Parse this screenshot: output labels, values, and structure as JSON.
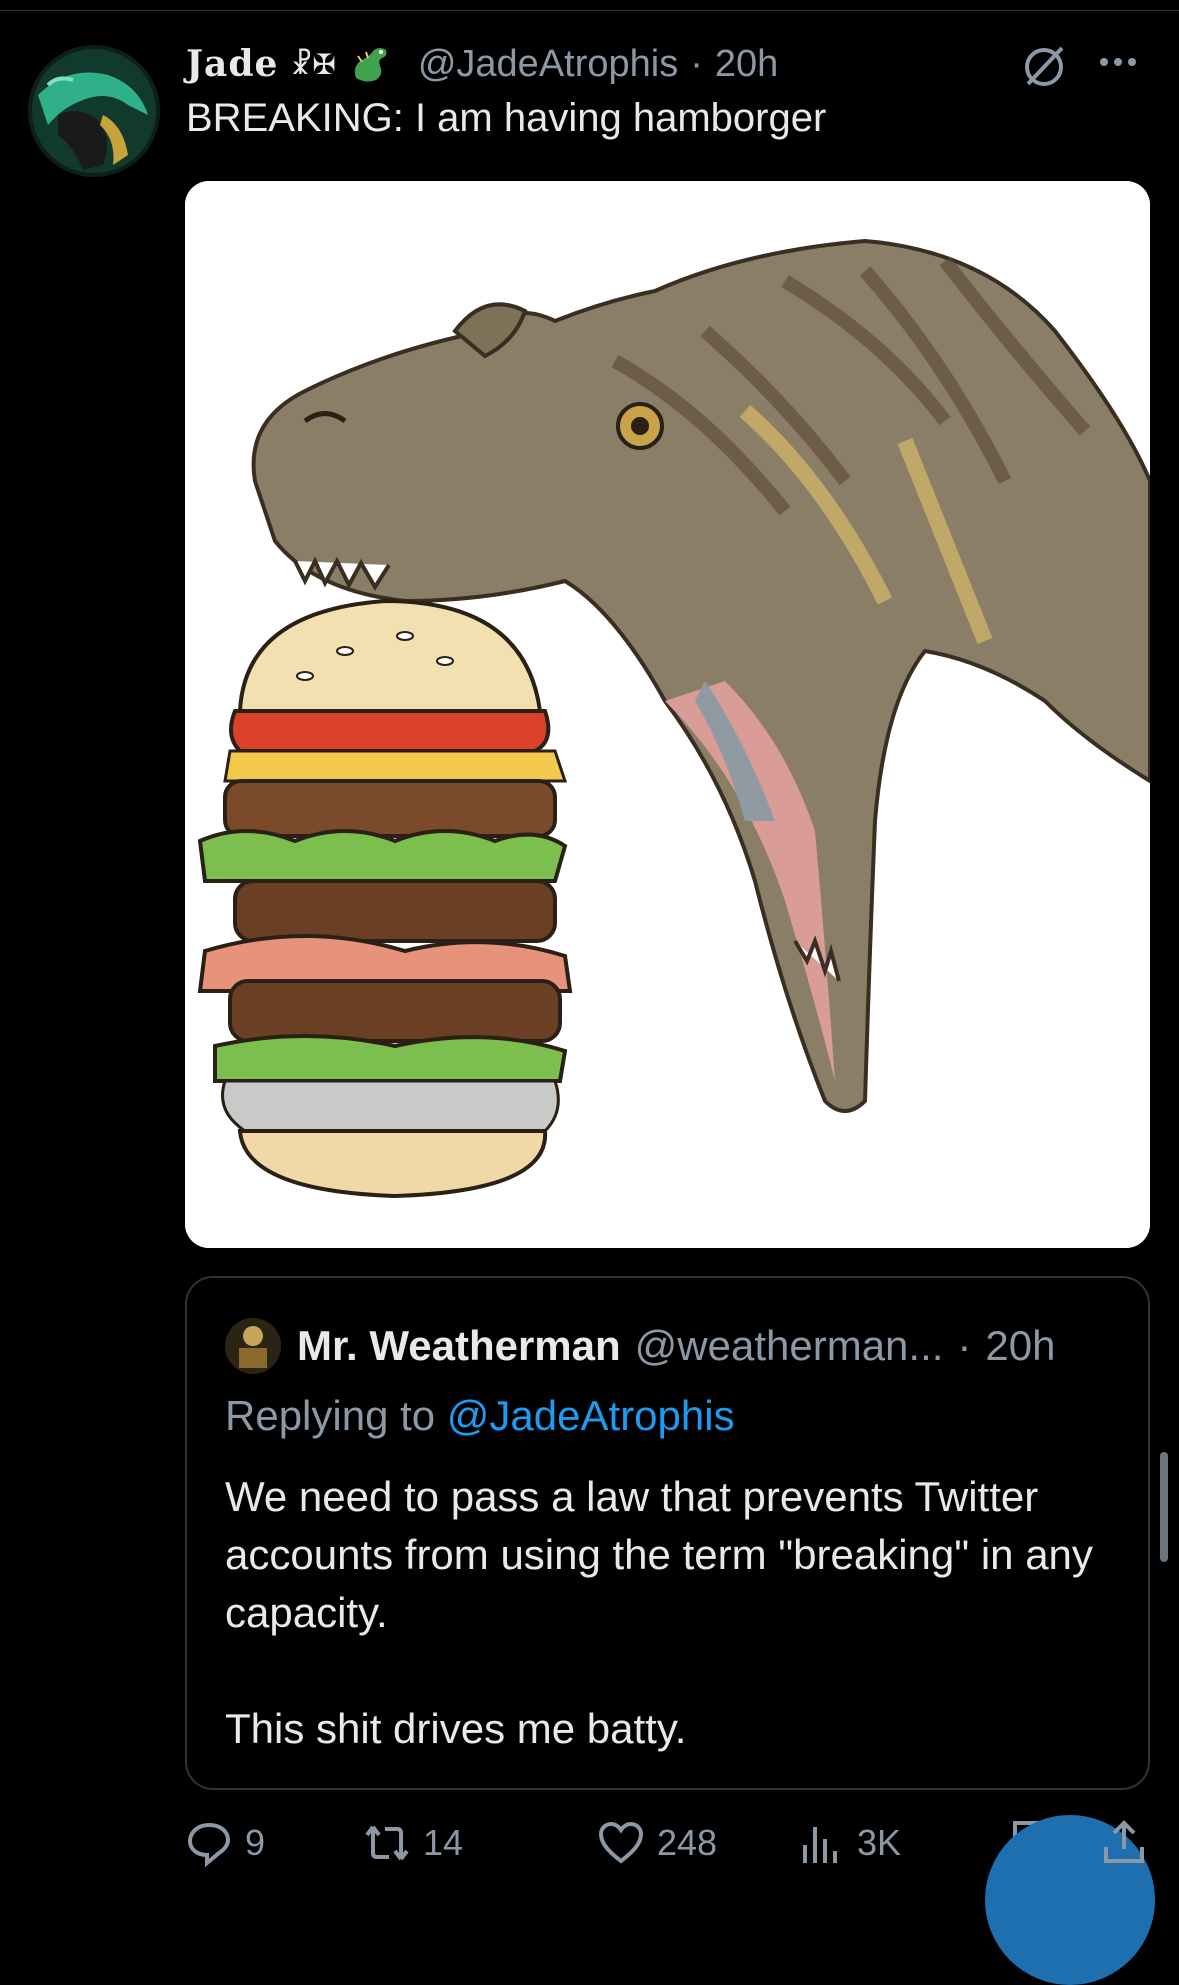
{
  "tweet": {
    "display_name": "Jade",
    "name_emojis": "☧✠",
    "handle": "@JadeAtrophis",
    "separator": "·",
    "time": "20h",
    "text": "BREAKING: I am having hamborger"
  },
  "quoted_tweet": {
    "display_name": "Mr. Weatherman",
    "handle": "@weatherman...",
    "separator": "·",
    "time": "20h",
    "replying_prefix": "Replying to",
    "replying_handle": "@JadeAtrophis",
    "body_line_1": "We need to pass a law that prevents Twitter accounts from using the term \"breaking\" in any capacity.",
    "body_line_2": "This shit drives me batty."
  },
  "actions": {
    "replies": "9",
    "retweets": "14",
    "likes": "248",
    "views": "3K"
  },
  "colors": {
    "background": "#000000",
    "text": "#e7e9ea",
    "secondary": "#8b98a5",
    "link": "#1d9bf0",
    "border": "#2f3336"
  },
  "icons": [
    "strikethrough-circle-icon",
    "more-icon",
    "reply-icon",
    "retweet-icon",
    "like-icon",
    "views-icon",
    "bookmark-icon",
    "share-icon"
  ]
}
